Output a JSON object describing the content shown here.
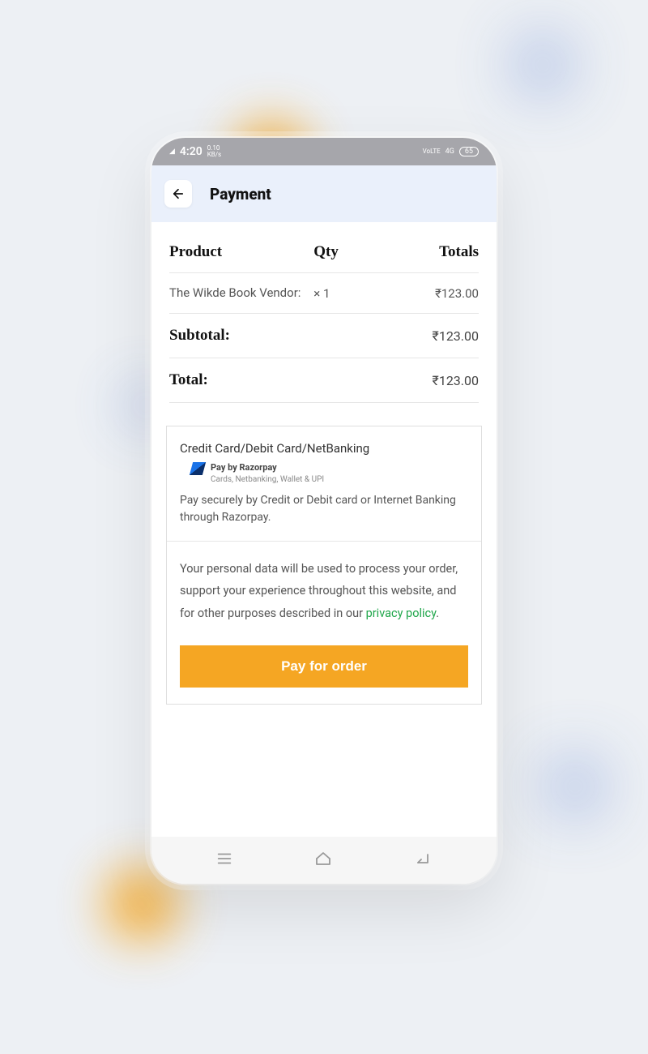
{
  "status": {
    "signal": "4G",
    "time": "4:20",
    "kb": "0.10",
    "kb_unit": "KB/s",
    "net": "VoLTE",
    "net2": "4G",
    "battery": "65"
  },
  "header": {
    "title": "Payment"
  },
  "table": {
    "col_product": "Product",
    "col_qty": "Qty",
    "col_totals": "Totals",
    "item_name": "The Wikde Book Vendor:",
    "item_qty": "× 1",
    "item_total": "₹123.00",
    "subtotal_label": "Subtotal:",
    "subtotal_value": "₹123.00",
    "total_label": "Total:",
    "total_value": "₹123.00"
  },
  "payment": {
    "method_title": "Credit Card/Debit Card/NetBanking",
    "razor_title": "Pay by Razorpay",
    "razor_sub": "Cards, Netbanking, Wallet & UPI",
    "method_desc": "Pay securely by Credit or Debit card or Internet Banking through Razorpay.",
    "privacy_text": "Your personal data will be used to process your order, support your experience throughout this website, and for other purposes described in our ",
    "privacy_link": "privacy policy",
    "privacy_dot": ".",
    "button": "Pay for order"
  }
}
